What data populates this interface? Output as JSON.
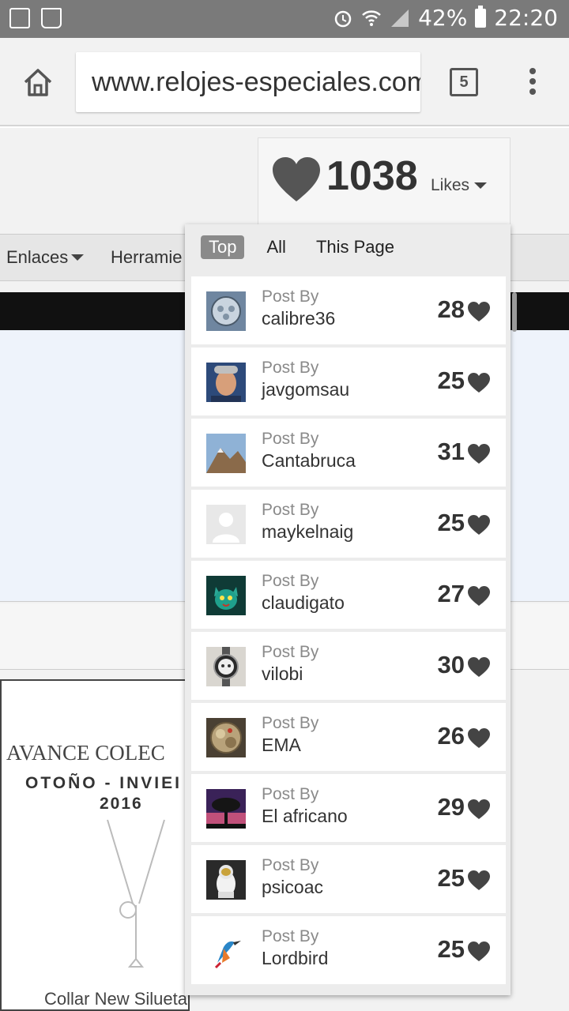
{
  "status_bar": {
    "battery_percent": "42%",
    "time": "22:20",
    "icons": [
      "image-icon",
      "recycle-icon",
      "alarm-icon",
      "wifi-icon",
      "signal-icon",
      "battery-icon"
    ]
  },
  "browser": {
    "url": "www.relojes-especiales.com",
    "tab_count": "5",
    "icons": [
      "home-icon",
      "tabs-icon",
      "overflow-menu-icon"
    ]
  },
  "page": {
    "nav_items": [
      {
        "label": "Enlaces"
      },
      {
        "label": "Herramie"
      }
    ],
    "poster": {
      "line1": "AVANCE COLEC",
      "line2": "OTOÑO - INVIEI",
      "line3": "2016",
      "caption": "Collar New Silueta"
    }
  },
  "likes": {
    "count": "1038",
    "label": "Likes",
    "filters": [
      {
        "label": "Top",
        "active": true
      },
      {
        "label": "All",
        "active": false
      },
      {
        "label": "This Page",
        "active": false
      }
    ],
    "post_by_label": "Post By",
    "entries": [
      {
        "user": "calibre36",
        "likes": "28",
        "avatar": "watch-dial"
      },
      {
        "user": "javgomsau",
        "likes": "25",
        "avatar": "man-portrait"
      },
      {
        "user": "Cantabruca",
        "likes": "31",
        "avatar": "mountain"
      },
      {
        "user": "maykelnaig",
        "likes": "25",
        "avatar": "default-user"
      },
      {
        "user": "claudigato",
        "likes": "27",
        "avatar": "cat"
      },
      {
        "user": "vilobi",
        "likes": "30",
        "avatar": "chronograph"
      },
      {
        "user": "EMA",
        "likes": "26",
        "avatar": "movement"
      },
      {
        "user": "El africano",
        "likes": "29",
        "avatar": "tree-sunset"
      },
      {
        "user": "psicoac",
        "likes": "25",
        "avatar": "astronaut"
      },
      {
        "user": "Lordbird",
        "likes": "25",
        "avatar": "bird"
      }
    ]
  }
}
